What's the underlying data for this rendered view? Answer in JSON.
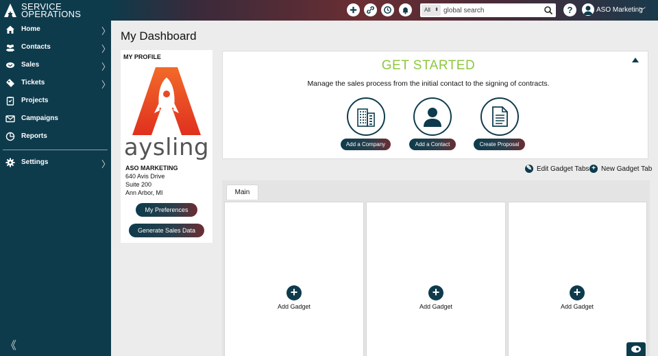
{
  "brand": {
    "line1": "SERVICE",
    "line2": "OPERATIONS"
  },
  "topbar": {
    "icons": [
      "add-icon",
      "link-icon",
      "history-icon",
      "notification-bell-icon"
    ],
    "search": {
      "scope": "All",
      "placeholder": "global search"
    },
    "help": "?",
    "user_name": "ASO Marketing"
  },
  "sidebar": {
    "items": [
      {
        "label": "Home",
        "icon": "home-icon",
        "has_children": true
      },
      {
        "label": "Contacts",
        "icon": "contacts-icon",
        "has_children": true
      },
      {
        "label": "Sales",
        "icon": "sales-icon",
        "has_children": true
      },
      {
        "label": "Tickets",
        "icon": "tickets-icon",
        "has_children": true
      },
      {
        "label": "Projects",
        "icon": "projects-icon",
        "has_children": false
      },
      {
        "label": "Campaigns",
        "icon": "campaigns-icon",
        "has_children": false
      },
      {
        "label": "Reports",
        "icon": "reports-icon",
        "has_children": false
      },
      {
        "label": "Settings",
        "icon": "settings-icon",
        "has_children": true
      }
    ],
    "chevron": "〉",
    "collapse": "《"
  },
  "page": {
    "title": "My Dashboard"
  },
  "profile": {
    "heading": "MY PROFILE",
    "company": "ASO MARKETING",
    "address1": "640 Avis Drive",
    "address2": "Suite 200",
    "city": "Ann Arbor, MI",
    "preferences_label": "My Preferences",
    "generate_label": "Generate Sales Data"
  },
  "get_started": {
    "title": "GET STARTED",
    "description": "Manage the sales process from the initial contact to the signing of contracts.",
    "actions": [
      {
        "label": "Add a Company",
        "icon": "building-icon"
      },
      {
        "label": "Add a Contact",
        "icon": "person-icon"
      },
      {
        "label": "Create Proposal",
        "icon": "document-icon"
      }
    ]
  },
  "gadget_tools": {
    "edit_label": "Edit Gadget Tabs",
    "new_label": "New Gadget Tab"
  },
  "tabs": [
    {
      "label": "Main",
      "active": true
    }
  ],
  "gadgets": [
    {
      "label": "Add Gadget"
    },
    {
      "label": "Add Gadget"
    },
    {
      "label": "Add Gadget"
    }
  ],
  "colors": {
    "navy": "#0e3b4c",
    "accent_green": "#8cc63f",
    "maroon": "#6b2d33"
  }
}
